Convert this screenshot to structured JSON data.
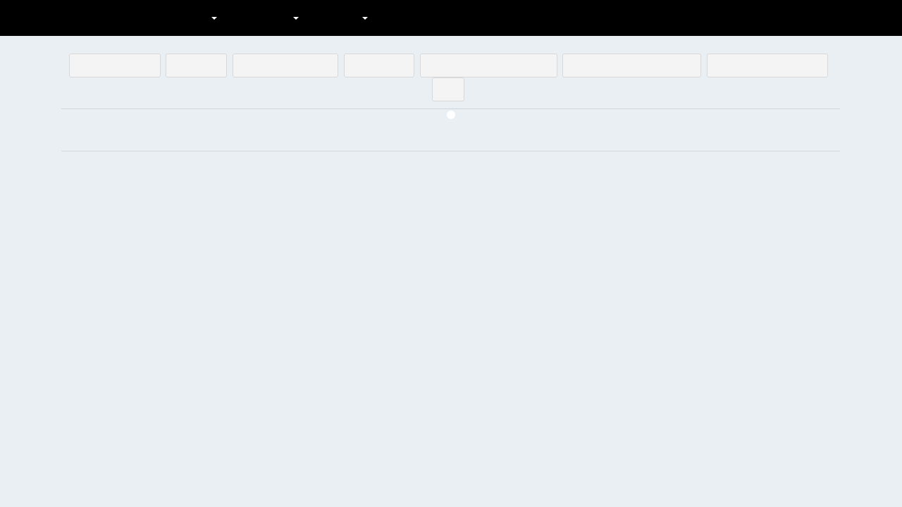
{
  "topbar": {
    "nav_items": [
      {
        "label": "",
        "icon": "caret-down-icon"
      },
      {
        "label": "",
        "icon": "caret-down-icon"
      },
      {
        "label": "",
        "icon": "caret-down-icon"
      }
    ]
  },
  "toolbar": {
    "buttons": [
      {
        "label": ""
      },
      {
        "label": ""
      },
      {
        "label": ""
      },
      {
        "label": ""
      },
      {
        "label": ""
      },
      {
        "label": ""
      },
      {
        "label": ""
      },
      {
        "label": ""
      }
    ]
  },
  "colors": {
    "topbar_bg": "#000000",
    "page_bg": "#eaeff4",
    "button_bg": "#f4f4f4",
    "button_border": "#d8d8d8",
    "divider": "#cfd6dd"
  }
}
